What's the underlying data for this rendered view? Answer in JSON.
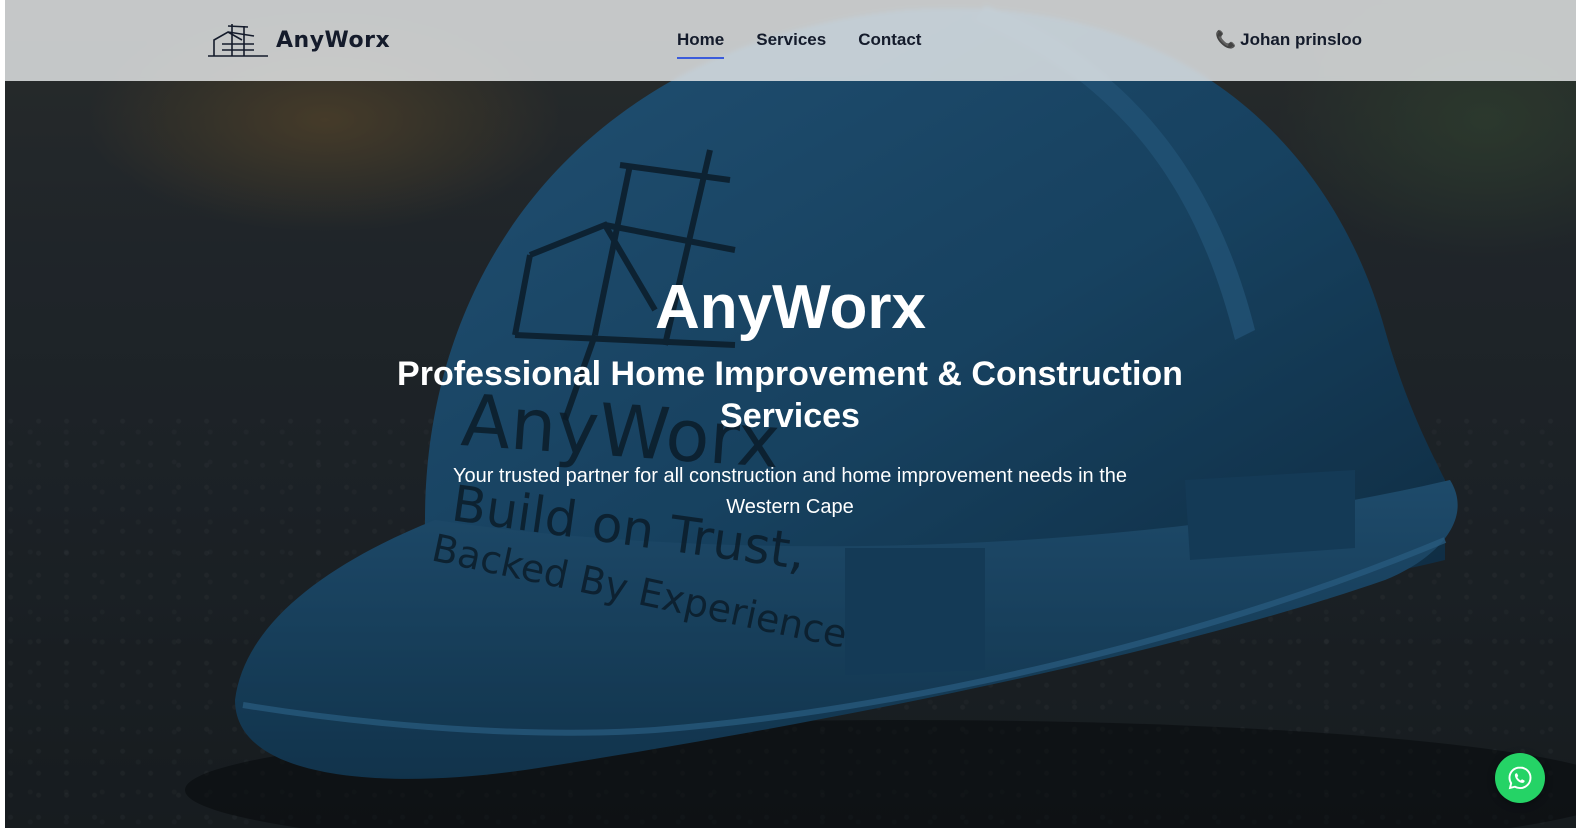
{
  "brand": {
    "name": "AnyWorx"
  },
  "nav": {
    "items": [
      {
        "label": "Home",
        "active": true
      },
      {
        "label": "Services",
        "active": false
      },
      {
        "label": "Contact",
        "active": false
      }
    ]
  },
  "contact": {
    "phone_icon": "phone-icon",
    "name": "Johan prinsloo"
  },
  "hero": {
    "title": "AnyWorx",
    "subtitle": "Professional Home Improvement & Construction Services",
    "description": "Your trusted partner for all construction and home improvement needs in the Western Cape",
    "helmet_print": {
      "brand": "AnyWorx",
      "line1": "Build on Trust,",
      "line2": "Backed By Experience"
    }
  },
  "floating": {
    "icon": "whatsapp-icon"
  },
  "colors": {
    "accent": "#3b5bdb",
    "text_dark": "#141b2b",
    "helmet_blue": "#1f5b86",
    "whatsapp_green": "#25d366"
  }
}
